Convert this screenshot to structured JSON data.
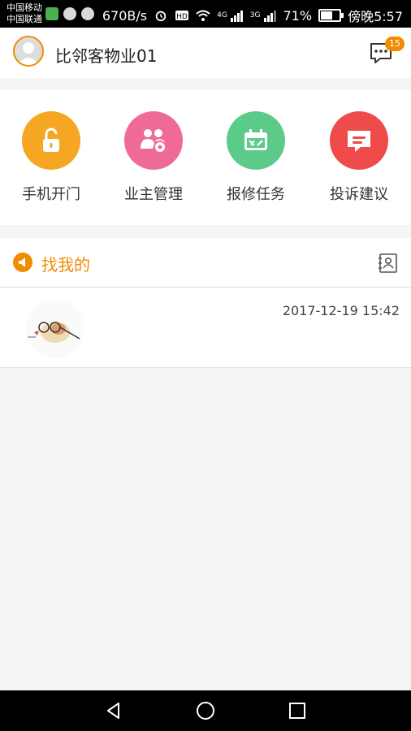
{
  "status_bar": {
    "carrier_1": "中国移动",
    "carrier_2": "中国联通",
    "speed": "670B/s",
    "network_4g": "4G",
    "network_3g": "3G",
    "battery": "71%",
    "battery_level": 0.71,
    "time": "傍晚5:57"
  },
  "header": {
    "title": "比邻客物业01",
    "badge_count": "15"
  },
  "menu": [
    {
      "label": "手机开门",
      "icon": "unlock-icon",
      "color": "#f5a623"
    },
    {
      "label": "业主管理",
      "icon": "users-gear-icon",
      "color": "#ef6a94"
    },
    {
      "label": "报修任务",
      "icon": "calendar-tools-icon",
      "color": "#5ccb8a"
    },
    {
      "label": "投诉建议",
      "icon": "message-icon",
      "color": "#ef4b4b"
    }
  ],
  "section": {
    "title": "找我的",
    "accent": "#f08c00"
  },
  "message": {
    "time": "2017-12-19 15:42"
  }
}
